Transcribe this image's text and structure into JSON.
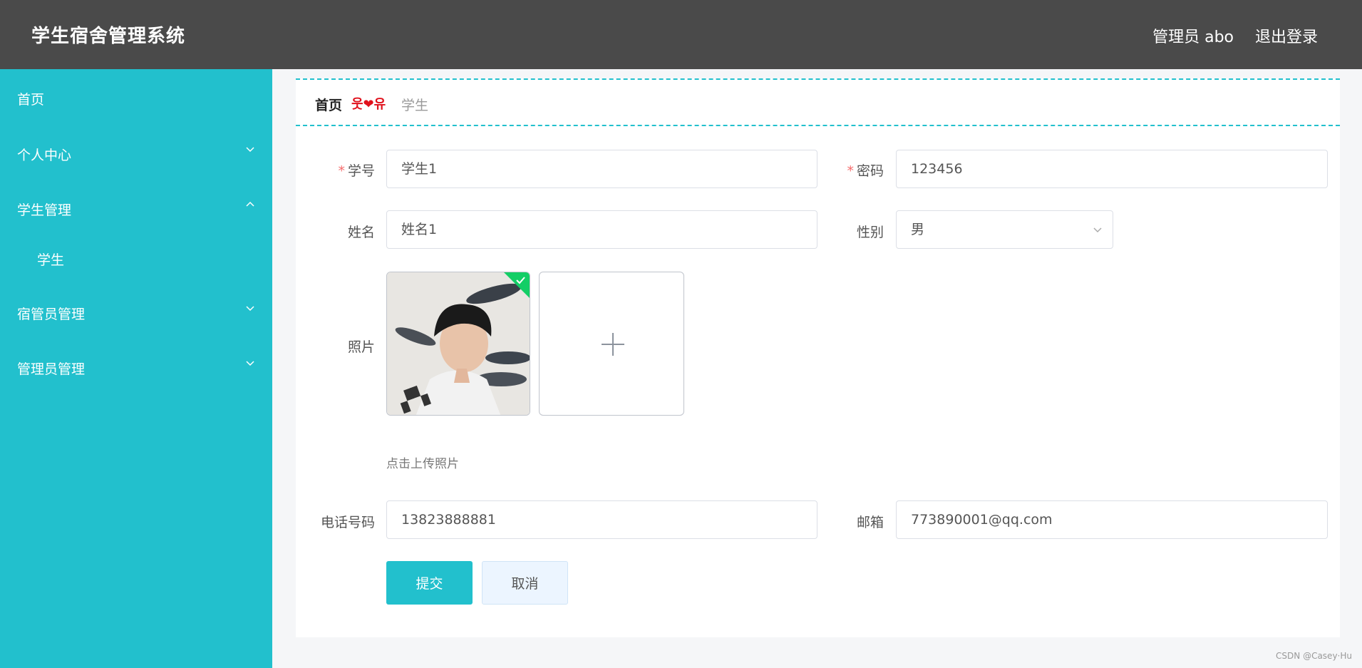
{
  "header": {
    "title": "学生宿舍管理系统",
    "user": "管理员 abo",
    "logout": "退出登录"
  },
  "sidebar": {
    "items": [
      {
        "label": "首页"
      },
      {
        "label": "个人中心",
        "icon": "chevron-down-icon"
      },
      {
        "label": "学生管理",
        "icon": "chevron-up-icon",
        "expanded": true
      },
      {
        "label": "学生"
      },
      {
        "label": "宿管员管理",
        "icon": "chevron-down-icon"
      },
      {
        "label": "管理员管理",
        "icon": "chevron-down-icon"
      }
    ],
    "color": "#22c0cd"
  },
  "breadcrumb": {
    "home": "首页",
    "separator": "웃❤유",
    "current": "学生"
  },
  "form": {
    "student_id": {
      "label": "学号",
      "value": "学生1",
      "required": true
    },
    "password": {
      "label": "密码",
      "value": "123456",
      "required": true
    },
    "name": {
      "label": "姓名",
      "value": "姓名1"
    },
    "gender": {
      "label": "性别",
      "value": "男"
    },
    "photo": {
      "label": "照片",
      "hint": "点击上传照片"
    },
    "phone": {
      "label": "电话号码",
      "value": "13823888881"
    },
    "email": {
      "label": "邮箱",
      "value": "773890001@qq.com"
    },
    "submit": "提交",
    "cancel": "取消"
  },
  "watermark": "CSDN @Casey·Hu"
}
